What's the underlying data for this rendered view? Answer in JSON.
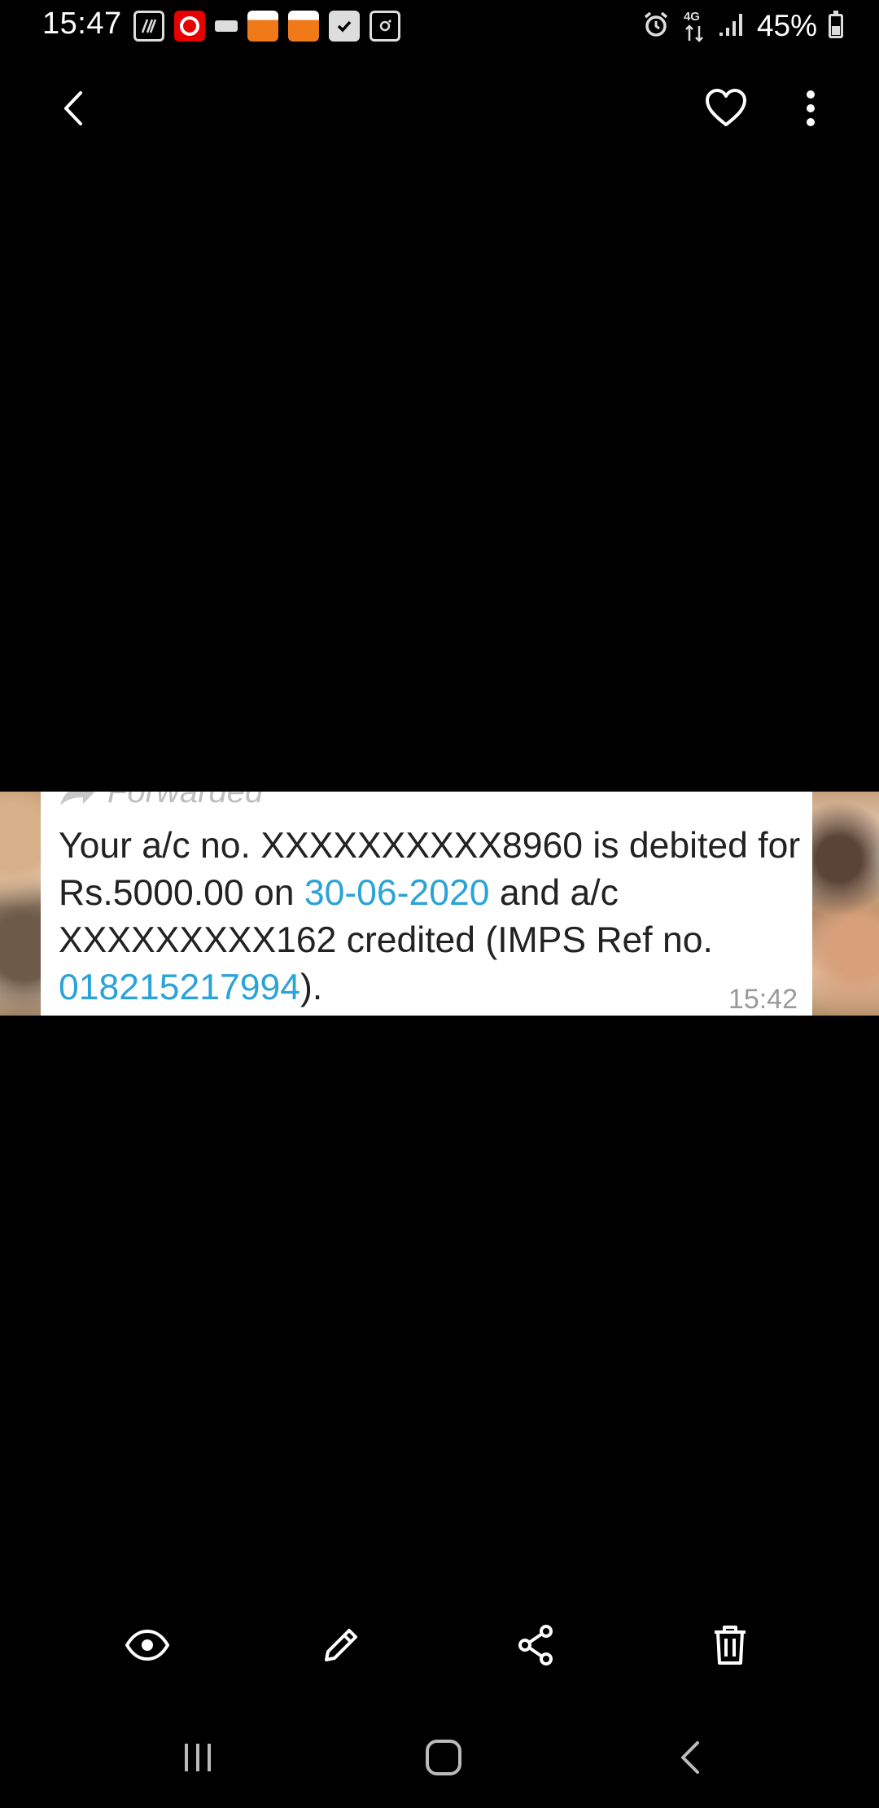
{
  "status_bar": {
    "time": "15:47",
    "battery": "45%",
    "battery_level": 0.45,
    "network": "4G",
    "notification_icons": [
      "app-hash-icon",
      "vodafone-icon",
      "idea-icon",
      "app-orange-icon",
      "app-orange-icon",
      "checkbox-icon",
      "instagram-icon"
    ]
  },
  "top_bar": {
    "icons": [
      "back-arrow-icon",
      "heart-icon",
      "more-vert-icon"
    ]
  },
  "message": {
    "forwarded_label": "Forwarded",
    "part1": "Your a/c no. XXXXXXXXXX8960 is debited for Rs.5000.00 on ",
    "date_link": "30-06-2020",
    "part2": " and a/c XXXXXXXXX162 credited (IMPS Ref no. ",
    "ref_link": "018215217994",
    "part3": ").",
    "time": "15:42"
  },
  "actions": {
    "icons": [
      "eye-icon",
      "pencil-icon",
      "share-icon",
      "trash-icon"
    ]
  },
  "nav": {
    "icons": [
      "recents-icon",
      "home-icon",
      "nav-back-icon"
    ]
  },
  "colors": {
    "background": "#000000",
    "link": "#2aa3d8",
    "message_text": "#222222",
    "timestamp": "#9a9a9a"
  }
}
